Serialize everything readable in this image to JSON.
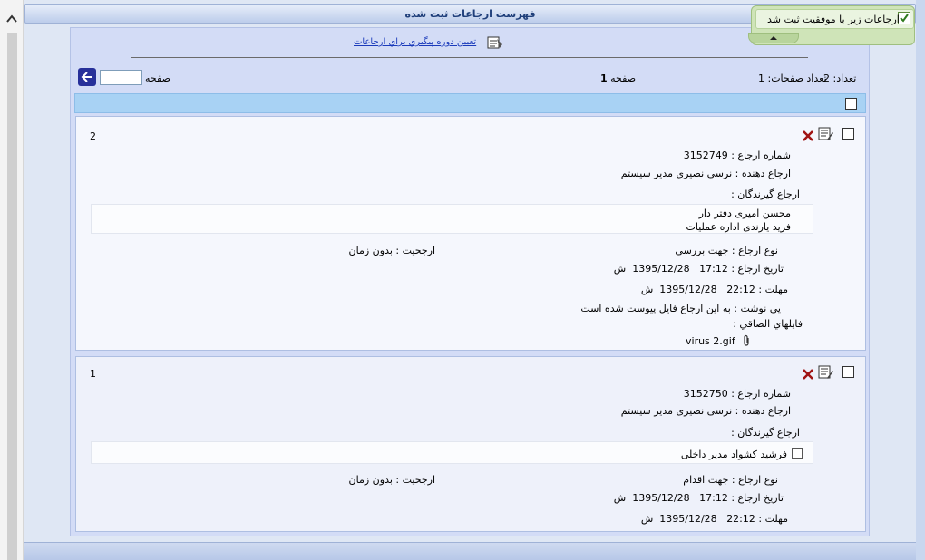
{
  "page": {
    "title": "فهرست ارجاعات ثبت شده"
  },
  "header": {
    "followup_link": "تعيين دوره پيگيري براي ارجاعات",
    "page_input_label": "صفحه",
    "page_input_value": "",
    "current_page_label": "صفحه",
    "current_page_value": "1",
    "page_count_text": "تعداد صفحات: 1",
    "total_count_text": "تعداد: 2"
  },
  "toast": {
    "message": "ارجاعات زير با موفقيت ثبت شد"
  },
  "records": [
    {
      "index": "2",
      "number_label": "شماره ارجاع :",
      "number_value": "3152749",
      "sender_label": "ارجاع دهنده :",
      "sender_value": "نرسی نصیری مدیر سیستم",
      "recipients_label": "ارجاع گيرندگان :",
      "recipients": [
        "محسن امیری دفتر دار",
        "فرید یارندی اداره عملیات"
      ],
      "type_label": "نوع ارجاع :",
      "type_value": "جهت بررسی",
      "priority_label": "ارجحيت :",
      "priority_value": "بدون زمان",
      "date_label": "تاريخ ارجاع :",
      "date_value": "17:12   1395/12/28  ش",
      "deadline_label": "مهلت :",
      "deadline_value": "22:12   1395/12/28  ش",
      "note_label": "پي نوشت :",
      "note_value": "به این ارجاع فایل پیوست شده است",
      "attachments_label": "فايلهاي الصاقي :",
      "attachment_name": "virus 2.gif"
    },
    {
      "index": "1",
      "number_label": "شماره ارجاع :",
      "number_value": "3152750",
      "sender_label": "ارجاع دهنده :",
      "sender_value": "نرسی نصیری مدیر سیستم",
      "recipients_label": "ارجاع گيرندگان :",
      "recipients": [
        "فرشید کشواد مدیر داخلی"
      ],
      "type_label": "نوع ارجاع :",
      "type_value": "جهت اقدام",
      "priority_label": "ارجحيت :",
      "priority_value": "بدون زمان",
      "date_label": "تاريخ ارجاع :",
      "date_value": "17:12   1395/12/28  ش",
      "deadline_label": "مهلت :",
      "deadline_value": "22:12   1395/12/28  ش"
    }
  ],
  "colors": {
    "accent": "#27309a",
    "link": "#1b3bbb",
    "delete": "#a01414",
    "toast_bg": "#cfe4b8"
  },
  "icons": {
    "scroll_up": "chevron-up-icon",
    "nav_go": "arrow-left-icon",
    "followup": "calendar-icon",
    "edit": "edit-note-icon",
    "delete": "delete-x-icon",
    "attachment": "paperclip-icon",
    "toast": "checkmark-icon"
  }
}
